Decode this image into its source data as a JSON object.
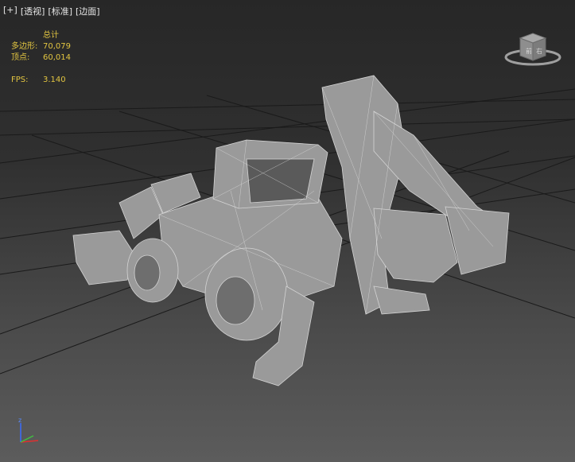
{
  "viewport": {
    "labels": [
      "[+]",
      "[透视]",
      "[标准]",
      "[边面]"
    ]
  },
  "stats": {
    "title": "总计",
    "polygons_label": "多边形:",
    "polygons_value": "70,079",
    "vertices_label": "顶点:",
    "vertices_value": "60,014",
    "fps_label": "FPS:",
    "fps_value": "3.140"
  },
  "viewcube": {
    "face_label": "前",
    "face_label_2": "右"
  },
  "axis": {
    "z": "z"
  },
  "colors": {
    "stats_text": "#e2c541",
    "grid": "#1a1a1a",
    "model": "#9a9a9a",
    "wire": "#cfcfcf"
  }
}
